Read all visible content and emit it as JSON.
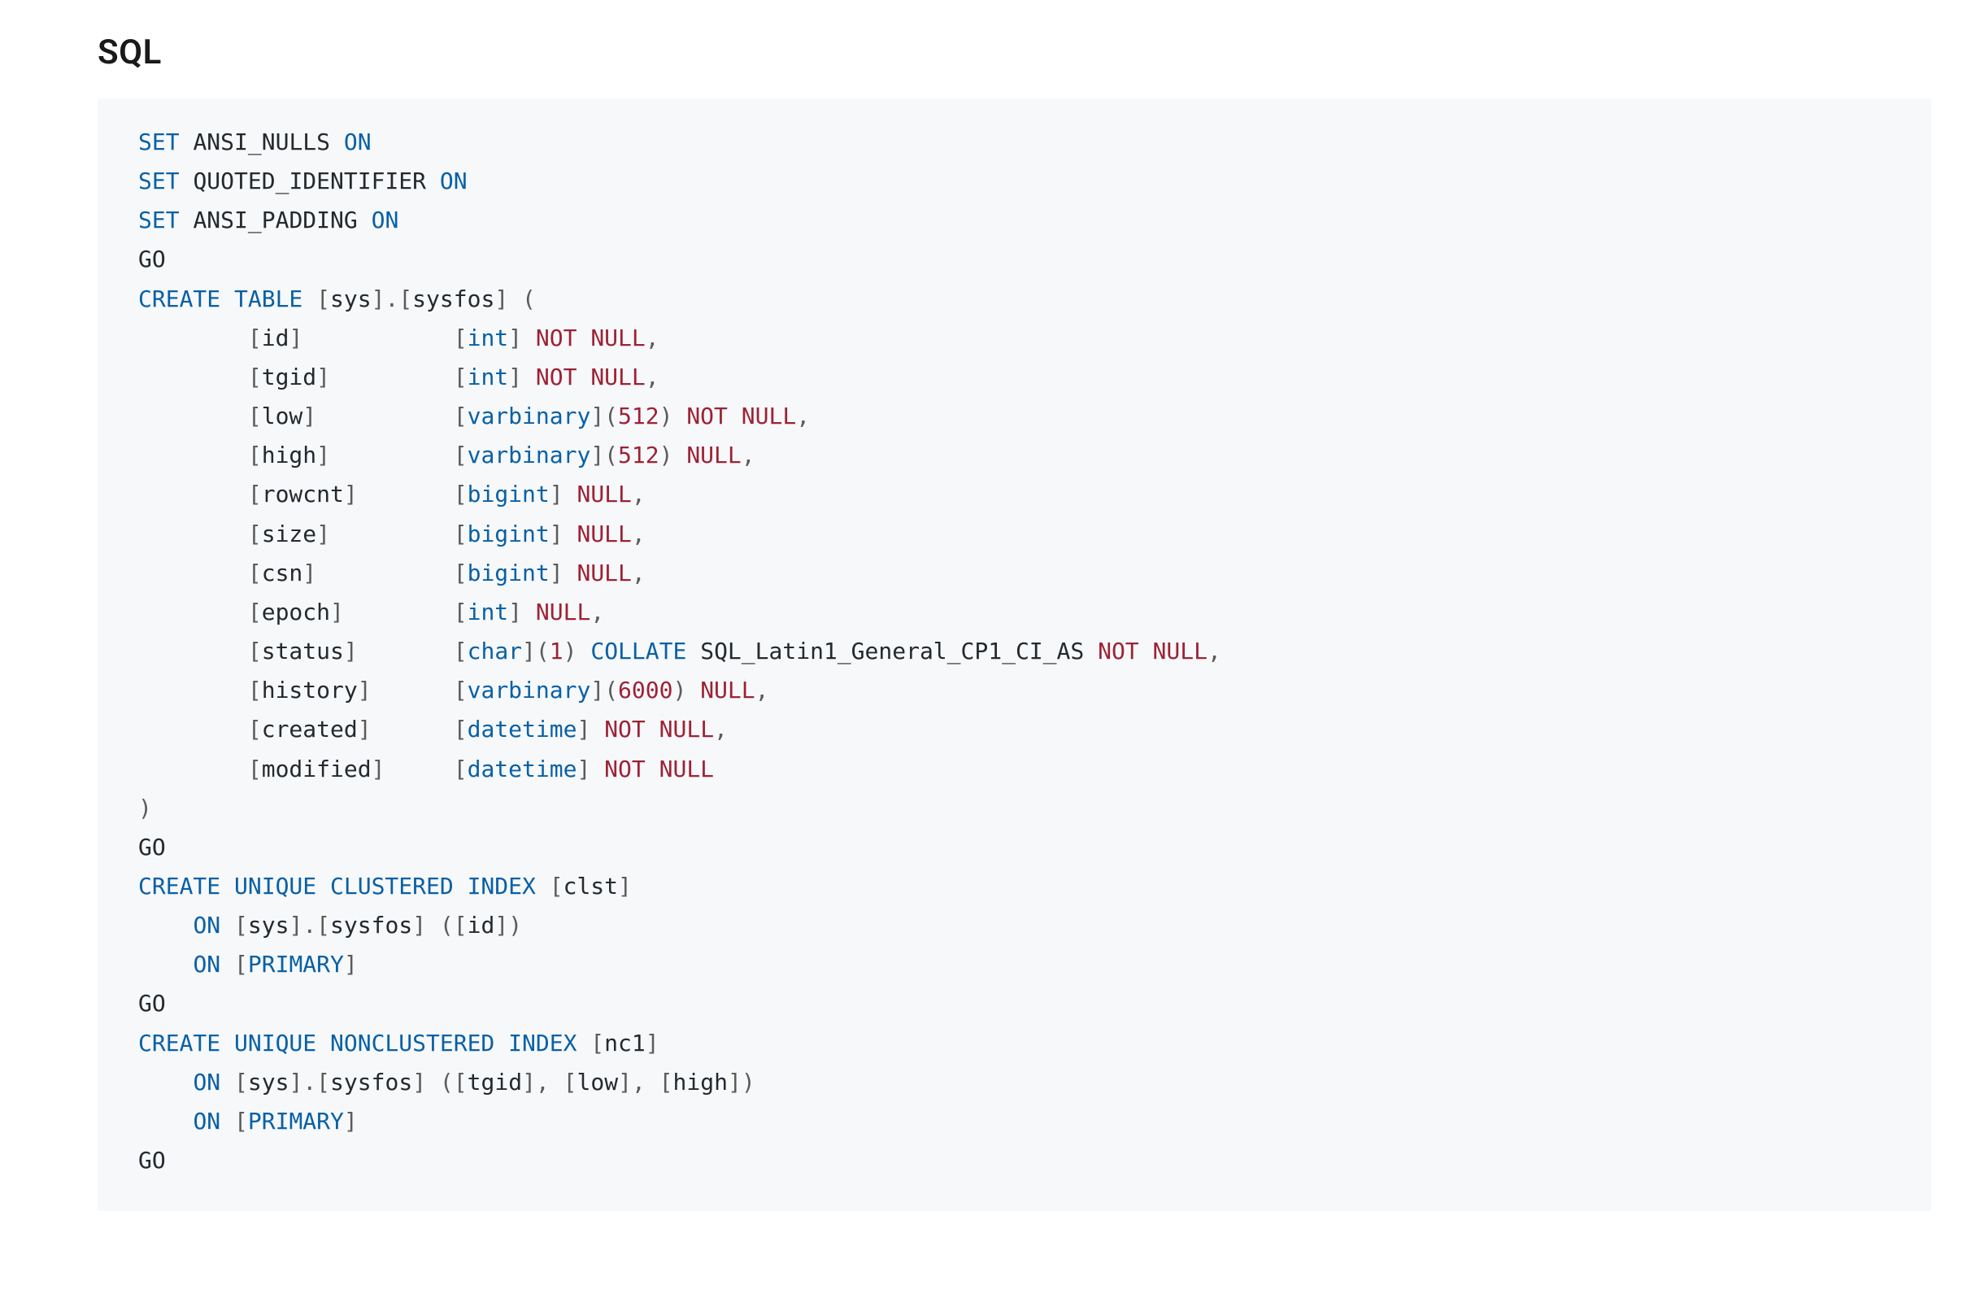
{
  "heading": "SQL",
  "sql": {
    "set_stmts": [
      {
        "kw": "SET",
        "name": "ANSI_NULLS",
        "state": "ON"
      },
      {
        "kw": "SET",
        "name": "QUOTED_IDENTIFIER",
        "state": "ON"
      },
      {
        "kw": "SET",
        "name": "ANSI_PADDING",
        "state": "ON"
      }
    ],
    "go": "GO",
    "create_table": {
      "kw": "CREATE TABLE",
      "schema": "sys",
      "table": "sysfos",
      "open": "(",
      "close": ")",
      "columns": [
        {
          "name": "id",
          "type": "int",
          "size": null,
          "collate": null,
          "nullability": "NOT NULL"
        },
        {
          "name": "tgid",
          "type": "int",
          "size": null,
          "collate": null,
          "nullability": "NOT NULL"
        },
        {
          "name": "low",
          "type": "varbinary",
          "size": "512",
          "collate": null,
          "nullability": "NOT NULL"
        },
        {
          "name": "high",
          "type": "varbinary",
          "size": "512",
          "collate": null,
          "nullability": "NULL"
        },
        {
          "name": "rowcnt",
          "type": "bigint",
          "size": null,
          "collate": null,
          "nullability": "NULL"
        },
        {
          "name": "size",
          "type": "bigint",
          "size": null,
          "collate": null,
          "nullability": "NULL"
        },
        {
          "name": "csn",
          "type": "bigint",
          "size": null,
          "collate": null,
          "nullability": "NULL"
        },
        {
          "name": "epoch",
          "type": "int",
          "size": null,
          "collate": null,
          "nullability": "NULL"
        },
        {
          "name": "status",
          "type": "char",
          "size": "1",
          "collate": "SQL_Latin1_General_CP1_CI_AS",
          "nullability": "NOT NULL"
        },
        {
          "name": "history",
          "type": "varbinary",
          "size": "6000",
          "collate": null,
          "nullability": "NULL"
        },
        {
          "name": "created",
          "type": "datetime",
          "size": null,
          "collate": null,
          "nullability": "NOT NULL"
        },
        {
          "name": "modified",
          "type": "datetime",
          "size": null,
          "collate": null,
          "nullability": "NOT NULL"
        }
      ]
    },
    "collate_kw": "COLLATE",
    "indexes": [
      {
        "kw": "CREATE UNIQUE CLUSTERED INDEX",
        "name": "clst",
        "on_kw": "ON",
        "schema": "sys",
        "table": "sysfos",
        "cols": [
          "id"
        ],
        "on2_kw": "ON",
        "filegroup": "PRIMARY"
      },
      {
        "kw": "CREATE UNIQUE NONCLUSTERED INDEX",
        "name": "nc1",
        "on_kw": "ON",
        "schema": "sys",
        "table": "sysfos",
        "cols": [
          "tgid",
          "low",
          "high"
        ],
        "on2_kw": "ON",
        "filegroup": "PRIMARY"
      }
    ]
  }
}
